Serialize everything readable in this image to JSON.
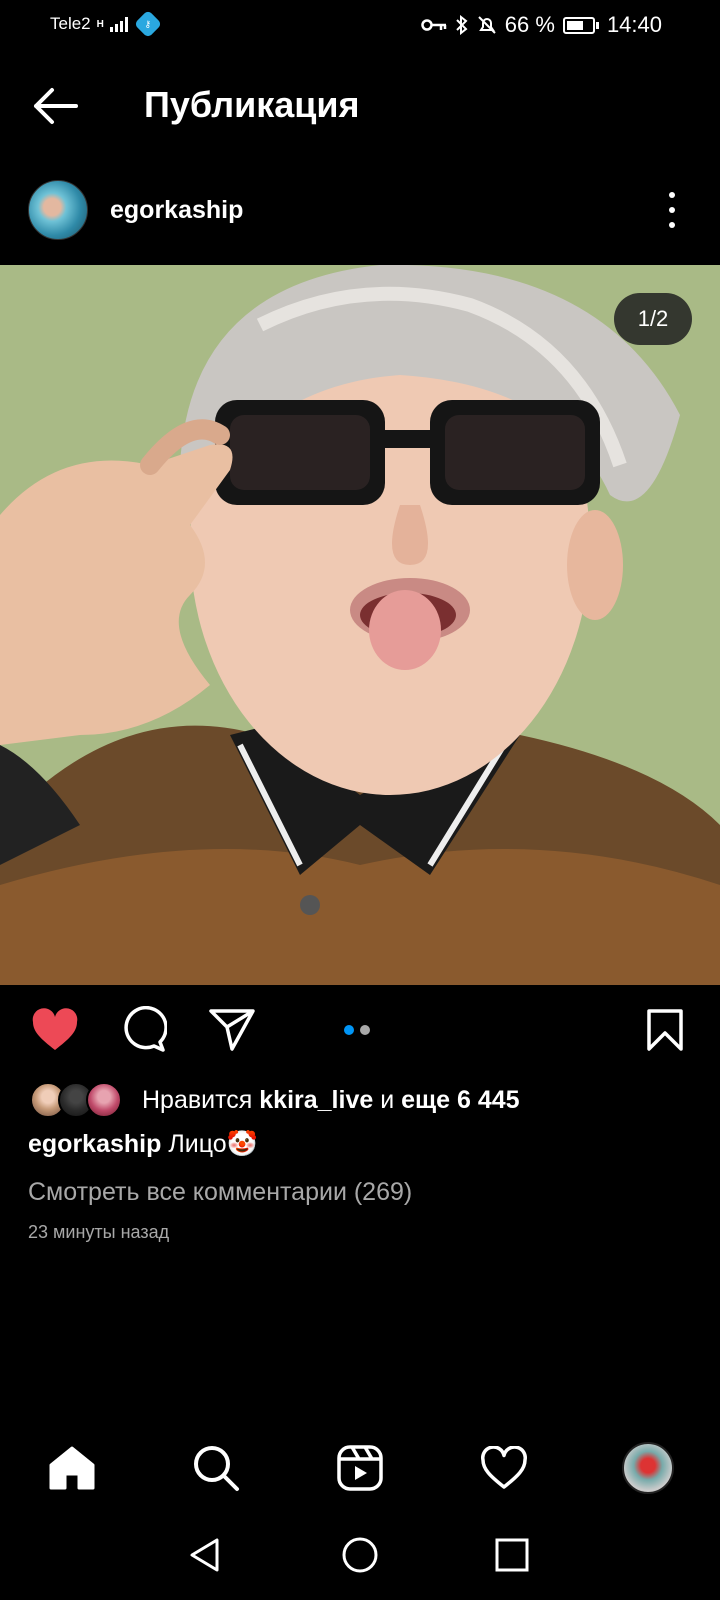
{
  "status_bar": {
    "carrier": "Tele2",
    "network_type": "H",
    "battery": "66 %",
    "battery_level": 0.66,
    "time": "14:40"
  },
  "header": {
    "title": "Публикация"
  },
  "post": {
    "author": "egorkaship",
    "page_indicator": "1/2",
    "current_page": 1,
    "total_pages": 2
  },
  "actions": {
    "liked": true,
    "like_color": "#ed4956",
    "active_dot_color": "#0095f6",
    "inactive_dot_color": "#a8a8a8"
  },
  "likes": {
    "prefix": "Нравится ",
    "user": "kkira_live",
    "connector": " и ",
    "others": "еще 6 445"
  },
  "caption": {
    "author": "egorkaship",
    "text": " Лицо🤡"
  },
  "comments": {
    "view_all": "Смотреть все комментарии (269)"
  },
  "timestamp": "23 минуты назад",
  "bottom_nav": {
    "items": [
      "home-icon",
      "search-icon",
      "reels-icon",
      "activity-icon",
      "profile-avatar"
    ]
  },
  "system_nav": {
    "items": [
      "back-icon",
      "home-circle-icon",
      "recents-icon"
    ]
  }
}
